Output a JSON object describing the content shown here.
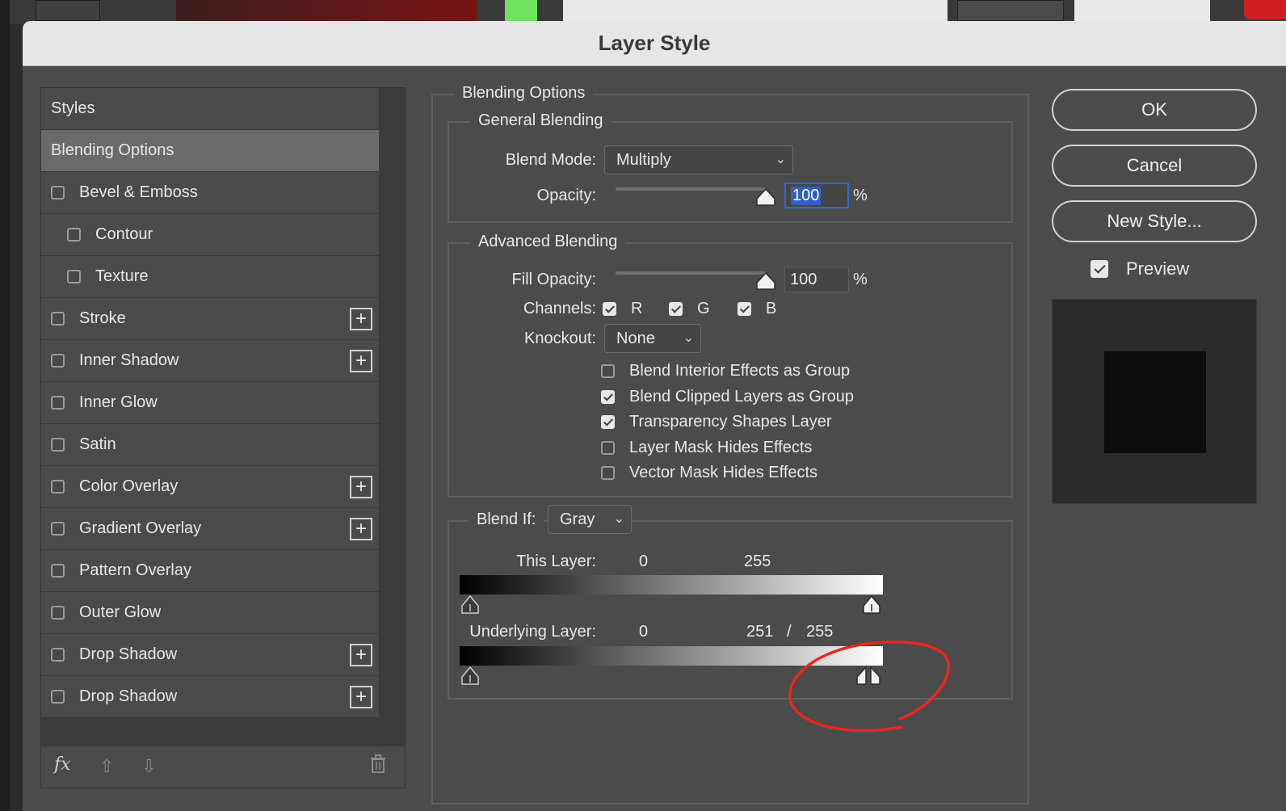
{
  "dialog": {
    "title": "Layer Style"
  },
  "styles": {
    "header": "Styles",
    "selected": "Blending Options",
    "items": [
      {
        "label": "Bevel & Emboss",
        "checked": false,
        "plus": false,
        "sub": false
      },
      {
        "label": "Contour",
        "checked": false,
        "plus": false,
        "sub": true
      },
      {
        "label": "Texture",
        "checked": false,
        "plus": false,
        "sub": true
      },
      {
        "label": "Stroke",
        "checked": false,
        "plus": true,
        "sub": false
      },
      {
        "label": "Inner Shadow",
        "checked": false,
        "plus": true,
        "sub": false
      },
      {
        "label": "Inner Glow",
        "checked": false,
        "plus": false,
        "sub": false
      },
      {
        "label": "Satin",
        "checked": false,
        "plus": false,
        "sub": false
      },
      {
        "label": "Color Overlay",
        "checked": false,
        "plus": true,
        "sub": false
      },
      {
        "label": "Gradient Overlay",
        "checked": false,
        "plus": true,
        "sub": false
      },
      {
        "label": "Pattern Overlay",
        "checked": false,
        "plus": false,
        "sub": false
      },
      {
        "label": "Outer Glow",
        "checked": false,
        "plus": false,
        "sub": false
      },
      {
        "label": "Drop Shadow",
        "checked": false,
        "plus": true,
        "sub": false
      },
      {
        "label": "Drop Shadow",
        "checked": false,
        "plus": true,
        "sub": false
      }
    ],
    "footer": {
      "fx": "fx",
      "up_icon": "arrow-up-icon",
      "down_icon": "arrow-down-icon",
      "trash_icon": "trash-icon"
    }
  },
  "blending": {
    "title": "Blending Options",
    "general": {
      "title": "General Blending",
      "blend_mode_label": "Blend Mode:",
      "blend_mode_value": "Multiply",
      "opacity_label": "Opacity:",
      "opacity_value": "100",
      "percent": "%"
    },
    "advanced": {
      "title": "Advanced Blending",
      "fill_opacity_label": "Fill Opacity:",
      "fill_opacity_value": "100",
      "percent": "%",
      "channels_label": "Channels:",
      "channels": [
        "R",
        "G",
        "B"
      ],
      "knockout_label": "Knockout:",
      "knockout_value": "None",
      "options": [
        {
          "label": "Blend Interior Effects as Group",
          "checked": false
        },
        {
          "label": "Blend Clipped Layers as Group",
          "checked": true
        },
        {
          "label": "Transparency Shapes Layer",
          "checked": true
        },
        {
          "label": "Layer Mask Hides Effects",
          "checked": false
        },
        {
          "label": "Vector Mask Hides Effects",
          "checked": false
        }
      ]
    },
    "blend_if": {
      "label": "Blend If:",
      "value": "Gray",
      "this_layer_label": "This Layer:",
      "this_layer_low": "0",
      "this_layer_high": "255",
      "underlying_label": "Underlying Layer:",
      "underlying_low": "0",
      "underlying_split_a": "251",
      "underlying_slash": "/",
      "underlying_split_b": "255"
    }
  },
  "buttons": {
    "ok": "OK",
    "cancel": "Cancel",
    "new_style": "New Style..."
  },
  "preview": {
    "label": "Preview",
    "checked": true
  },
  "colors": {
    "annotation": "#e8281c",
    "focus": "#2d6ad1"
  }
}
